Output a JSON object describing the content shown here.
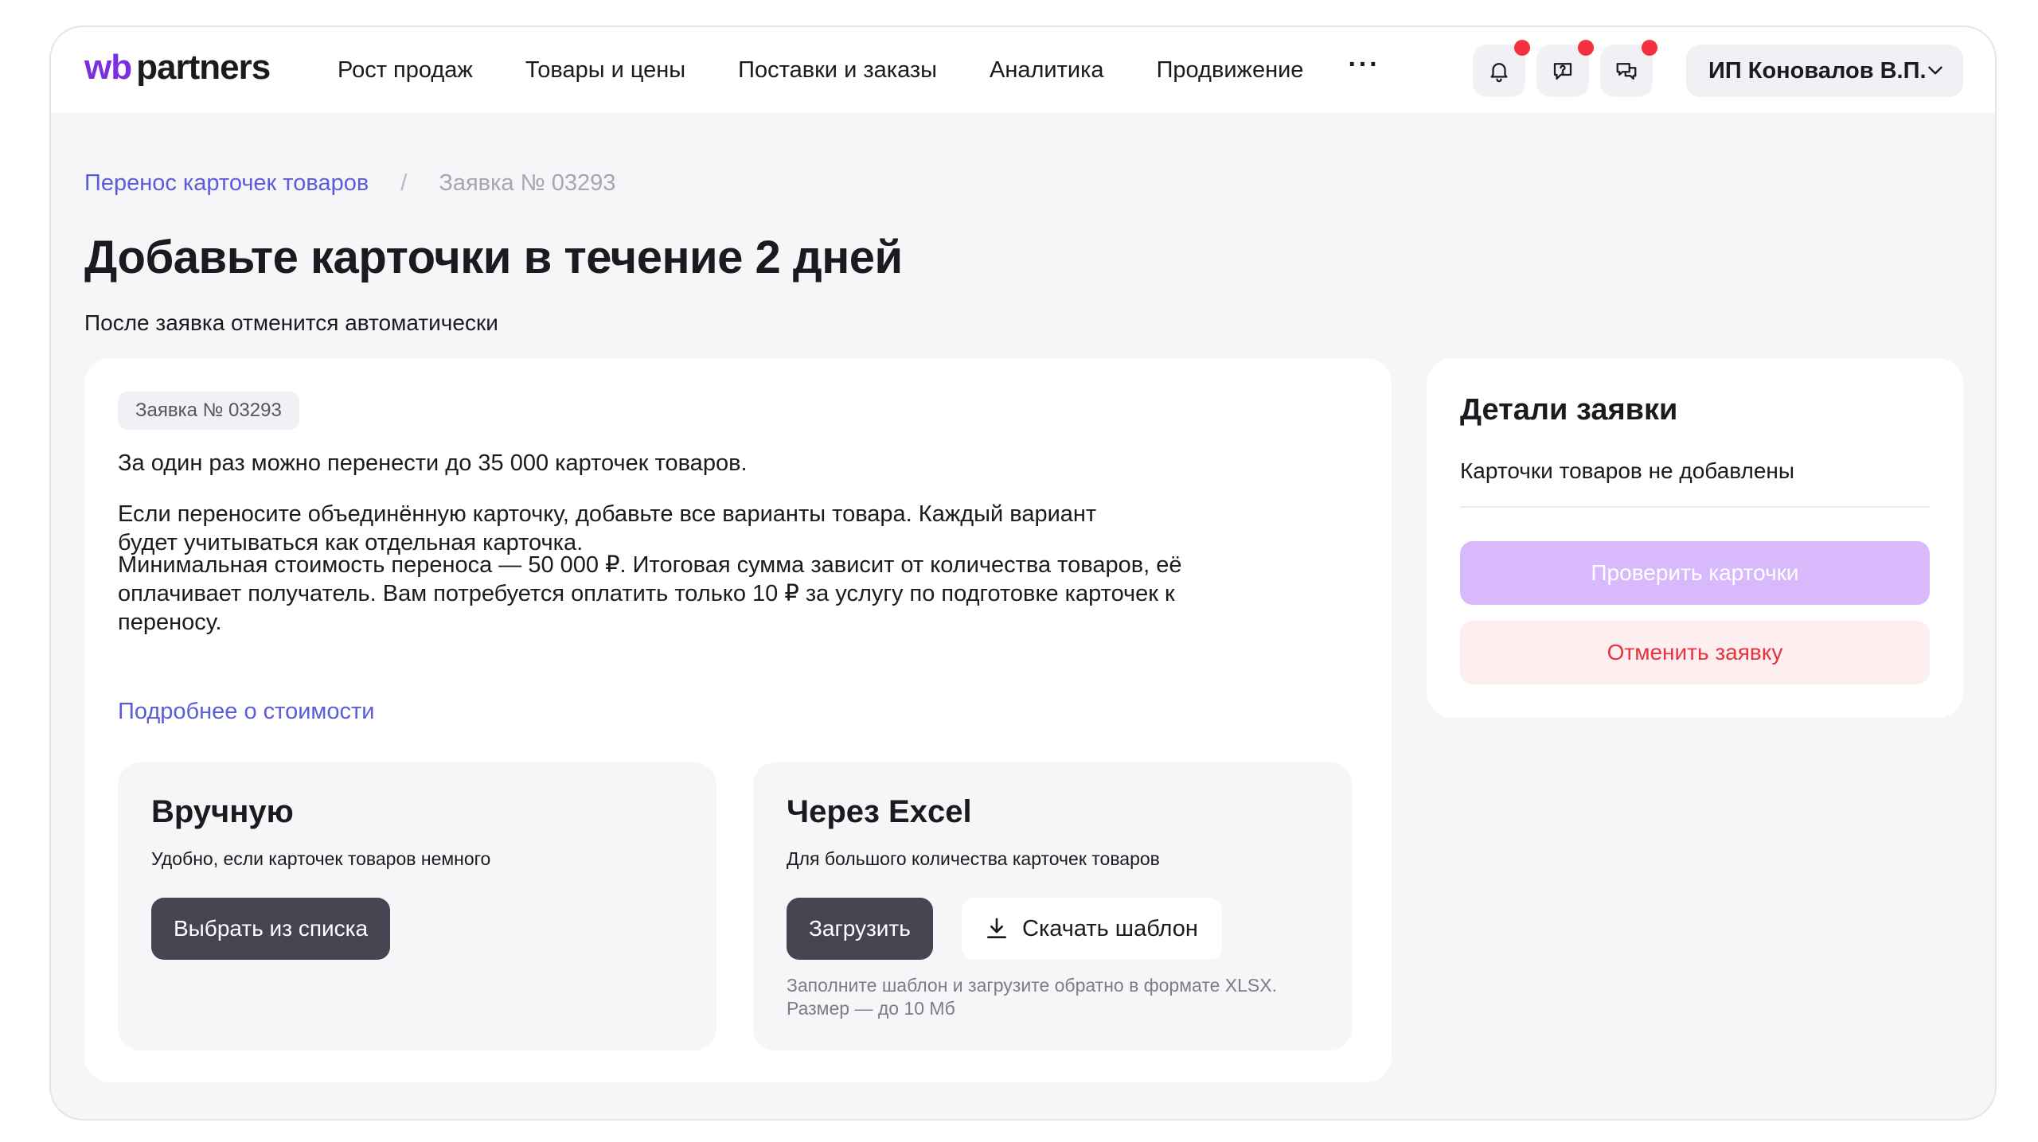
{
  "header": {
    "logo_wb": "wb",
    "logo_partners": "partners",
    "nav": [
      {
        "label": "Рост продаж"
      },
      {
        "label": "Товары и цены"
      },
      {
        "label": "Поставки и заказы"
      },
      {
        "label": "Аналитика"
      },
      {
        "label": "Продвижение"
      }
    ],
    "more_label": "···",
    "user_name": "ИП Коновалов В.П.",
    "icons": [
      "bell-icon",
      "support-chat-icon",
      "messages-icon",
      "chevron-down-icon"
    ],
    "notification_dot_color": "#f3323f"
  },
  "breadcrumb": {
    "link": "Перенос карточек товаров",
    "separator": "/",
    "current": "Заявка № 03293"
  },
  "page": {
    "title": "Добавьте карточки в течение 2 дней",
    "subtitle": "После заявка отменится автоматически"
  },
  "main": {
    "badge": "Заявка № 03293",
    "paragraphs": [
      "За один раз можно перенести до 35 000 карточек товаров.",
      "Если переносите объединённую карточку, добавьте все варианты товара. Каждый вариант будет учитываться как отдельная карточка.",
      "Минимальная стоимость переноса — 50 000 ₽. Итоговая сумма зависит от количества товаров, её оплачивает получатель. Вам потребуется оплатить только 10 ₽ за услугу по подготовке карточек к переносу."
    ],
    "more_link": "Подробнее о стоимости",
    "manual": {
      "title": "Вручную",
      "desc": "Удобно, если карточек товаров немного",
      "button": "Выбрать из списка"
    },
    "excel": {
      "title": "Через Excel",
      "desc": "Для большого количества карточек товаров",
      "upload_button": "Загрузить",
      "template_button": "Скачать шаблон",
      "hint": "Заполните шаблон и загрузите обратно в формате XLSX. Размер — до 10 Мб"
    }
  },
  "side": {
    "title": "Детали заявки",
    "status": "Карточки товаров не добавлены",
    "check_button": "Проверить карточки",
    "cancel_button": "Отменить заявку"
  },
  "colors": {
    "brand": "#7b2fe0",
    "link": "#5b5bdb",
    "primary_disabled": "#d8b9fb",
    "danger": "#e8323f",
    "danger_bg": "#fdeff0",
    "dark_button": "#454552"
  }
}
